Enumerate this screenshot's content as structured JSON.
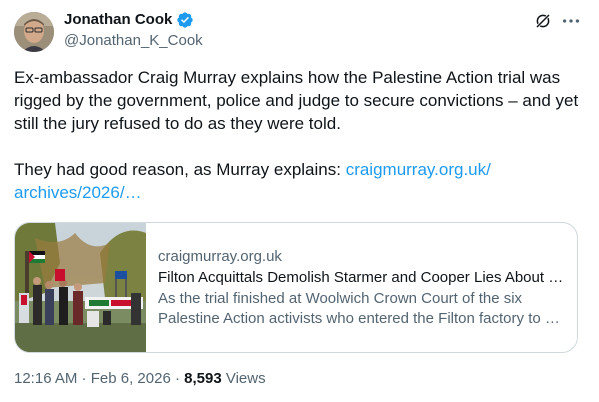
{
  "author": {
    "name": "Jonathan Cook",
    "handle": "@Jonathan_K_Cook",
    "verified_color": "#1d9bf0"
  },
  "icons": {
    "avatar": "avatar-photo",
    "verified": "verified-badge-icon",
    "grok": "grok-icon",
    "more": "more-options-icon"
  },
  "tweet": {
    "paragraph1": "Ex-ambassador Craig Murray explains how the Palestine Action trial was rigged by the government, police and judge to secure convictions – and yet still the jury refused to do as they were told.",
    "paragraph2_text": "They had good reason, as Murray explains: ",
    "link_text": "craigmurray.org.uk/ archives/2026/…",
    "link_color": "#1d9bf0"
  },
  "card": {
    "domain": "craigmurray.org.uk",
    "title": "Filton Acquittals Demolish Starmer and Cooper Lies About …",
    "description_line1": "As the trial finished at Woolwich Crown Court of the six",
    "description_line2": "Palestine Action activists who entered the Filton factory to …"
  },
  "meta": {
    "time": "12:16 AM",
    "separator1": " · ",
    "date": "Feb 6, 2026",
    "separator2": " · ",
    "views_count": "8,593",
    "views_label": " Views"
  }
}
